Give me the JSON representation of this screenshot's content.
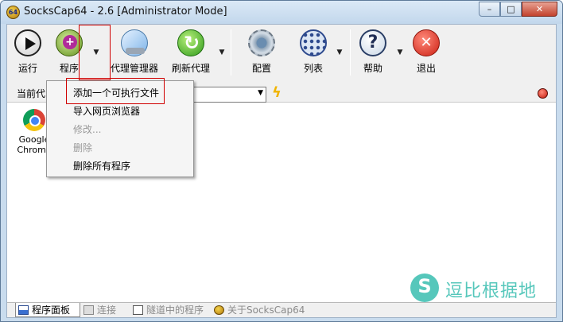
{
  "window": {
    "app_icon_text": "64",
    "title": "SocksCap64 - 2.6 [Administrator Mode]",
    "minimize": "–",
    "maximize": "□",
    "close": "✕"
  },
  "toolbar": {
    "run": "运行",
    "program": "程序",
    "proxy_manager": "代理管理器",
    "refresh_proxy": "刷新代理",
    "config": "配置",
    "list": "列表",
    "help": "帮助",
    "exit": "退出",
    "dropdown_arrow": "▼"
  },
  "proxybar": {
    "label": "当前代",
    "select_value": "",
    "bolt": "ϟ"
  },
  "programs": [
    {
      "name": "Google Chrome",
      "icon": "chrome-icon"
    }
  ],
  "menu": {
    "items": [
      {
        "label": "添加一个可执行文件",
        "enabled": true
      },
      {
        "label": "导入网页浏览器",
        "enabled": true
      },
      {
        "label": "修改...",
        "enabled": false
      },
      {
        "label": "删除",
        "enabled": false
      },
      {
        "label": "删除所有程序",
        "enabled": true
      }
    ]
  },
  "tabs": [
    {
      "label": "程序面板",
      "active": true
    },
    {
      "label": "连接",
      "active": false
    },
    {
      "label": "隧道中的程序",
      "active": false
    },
    {
      "label": "关于SocksCap64",
      "active": false
    }
  ],
  "watermark": {
    "text": "逗比根据地"
  },
  "colors": {
    "highlight": "#d00000",
    "watermark": "#56c7bb"
  }
}
